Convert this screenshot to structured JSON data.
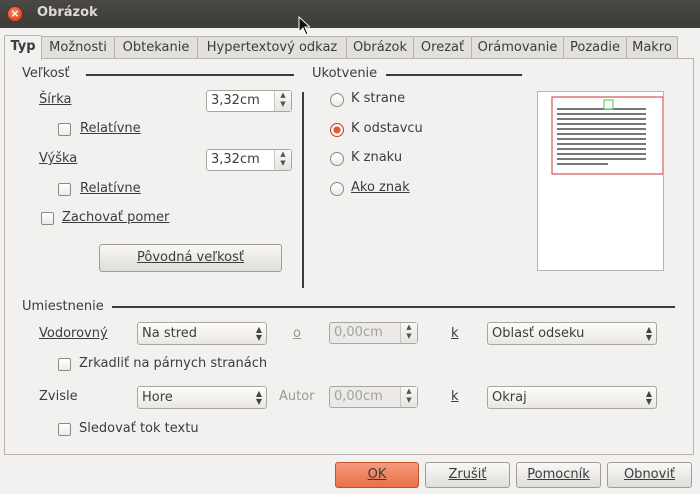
{
  "window": {
    "title": "Obrázok"
  },
  "tabs": [
    "Typ",
    "Možnosti",
    "Obtekanie",
    "Hypertextový odkaz",
    "Obrázok",
    "Orezať",
    "Orámovanie",
    "Pozadie",
    "Makro"
  ],
  "size": {
    "heading": "Veľkosť",
    "width_label": "Šírka",
    "width_value": "3,32cm",
    "width_relative": "Relatívne",
    "height_label": "Výška",
    "height_value": "3,32cm",
    "height_relative": "Relatívne",
    "keep_ratio": "Zachovať pomer",
    "original_size_button": "Pôvodná veľkosť"
  },
  "anchor": {
    "heading": "Ukotvenie",
    "options": [
      "K strane",
      "K odstavcu",
      "K znaku",
      "Ako znak"
    ],
    "selected_index": 1
  },
  "position": {
    "heading": "Umiestnenie",
    "horizontal_label": "Vodorovný",
    "horizontal_value": "Na stred",
    "horizontal_by_label": "o",
    "horizontal_by_value": "0,00cm",
    "horizontal_to_label": "k",
    "horizontal_to_value": "Oblasť odseku",
    "mirror_label": "Zrkadliť na párnych stranách",
    "vertical_label": "Zvisle",
    "vertical_value": "Hore",
    "vertical_by_label": "Autor",
    "vertical_by_value": "0,00cm",
    "vertical_to_label": "k",
    "vertical_to_value": "Okraj",
    "follow_text_label": "Sledovať tok textu"
  },
  "buttons": {
    "ok": "OK",
    "reset": "Zrušiť",
    "help": "Pomocník",
    "restore": "Obnoviť"
  },
  "colors": {
    "accent": "#e8704a",
    "titlebar": "#3c3b37",
    "anchor_frame": "#cc3333",
    "anchor_marker": "#44cc44"
  }
}
